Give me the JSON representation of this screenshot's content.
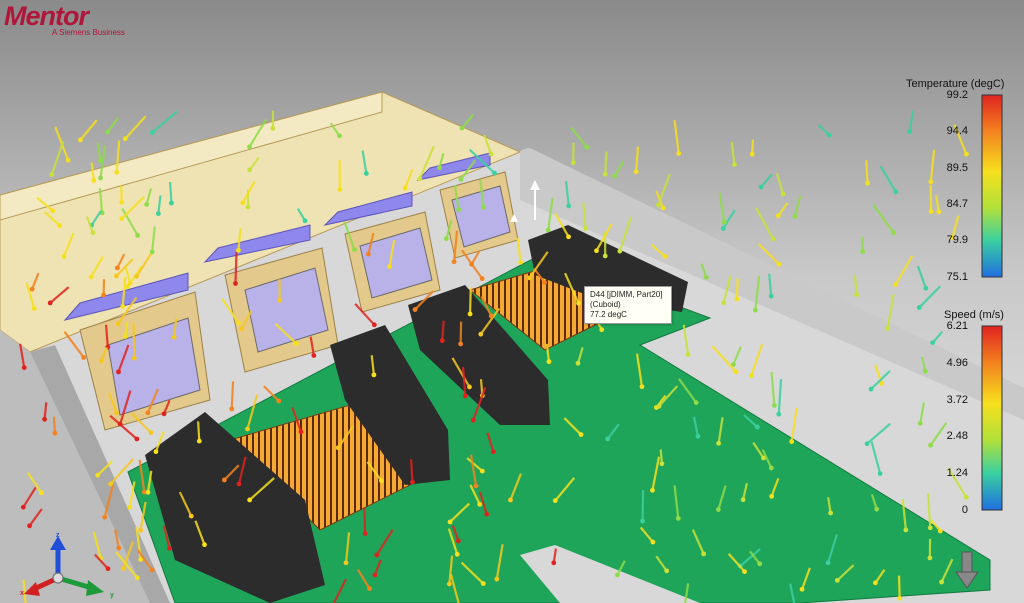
{
  "logo": {
    "name": "Mentor",
    "tagline": "A Siemens Business"
  },
  "legends": {
    "temperature": {
      "title": "Temperature (degC)",
      "ticks": [
        "99.2",
        "94.4",
        "89.5",
        "84.7",
        "79.9",
        "75.1"
      ]
    },
    "speed": {
      "title": "Speed (m/s)",
      "ticks": [
        "6.21",
        "4.96",
        "3.72",
        "2.48",
        "1.24",
        "0"
      ]
    }
  },
  "tooltip": {
    "line1": "D44 [jDIMM, Part20]",
    "line2": "(Cuboid)",
    "line3": "77.2 degC"
  },
  "axes": {
    "x": "x",
    "y": "y",
    "z": "z"
  },
  "colors": {
    "pcb": "#1ea55a",
    "enclosure_wall": "#efe3b4",
    "fan_frame": "#e4c98c",
    "fan_cap": "#8f88ec",
    "fan_center": "#b8b2e8",
    "dimm": "#2c2c2c",
    "temp_high": "#e0231f",
    "temp_low": "#1f6fe0",
    "background": "#e9e9e9"
  },
  "icons": {
    "view_down": "down-arrow-icon",
    "triad": "axis-triad-icon"
  }
}
